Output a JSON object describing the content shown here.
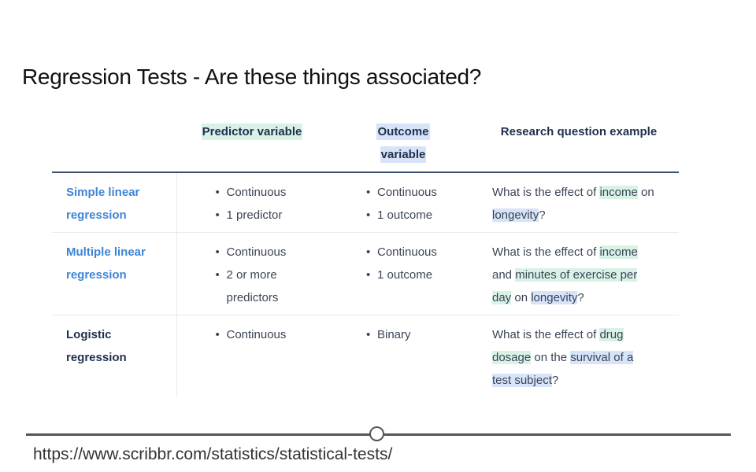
{
  "slide": {
    "title": "Regression Tests - Are these things associated?",
    "source_url": "https://www.scribbr.com/statistics/statistical-tests/"
  },
  "table": {
    "headers": {
      "col1": "",
      "predictor": "Predictor variable",
      "outcome_line1": "Outcome",
      "outcome_line2": "variable",
      "research": "Research question example"
    },
    "rows": [
      {
        "label_line1": "Simple linear",
        "label_line2": "regression",
        "predictor": [
          "Continuous",
          "1 predictor"
        ],
        "outcome": [
          "Continuous",
          "1 outcome"
        ],
        "question": {
          "p1": "What is the effect of ",
          "h1": "income",
          "p2": " on ",
          "h2": "longevity",
          "p3": "?"
        }
      },
      {
        "label_line1": "Multiple linear",
        "label_line2": "regression",
        "predictor": [
          "Continuous",
          "2 or more",
          "predictors"
        ],
        "outcome": [
          "Continuous",
          "1 outcome"
        ],
        "question": {
          "p1": "What is the effect of ",
          "h1": "income",
          "p2": " and ",
          "h2": "minutes of exercise per day",
          "p3": " on ",
          "h3": "longevity",
          "p4": "?"
        }
      },
      {
        "label_line1": "Logistic",
        "label_line2": "regression",
        "predictor": [
          "Continuous"
        ],
        "outcome": [
          "Binary"
        ],
        "question": {
          "p1": "What is the effect of ",
          "h1": "drug dosage",
          "p2": " on the ",
          "h2": "survival of a test subject",
          "p3": "?"
        }
      }
    ]
  },
  "colors": {
    "predictor_highlight": "#d9f2e6",
    "outcome_highlight": "#d6e3f8",
    "link_label": "#3d85d6",
    "header_rule": "#3b4f72"
  }
}
